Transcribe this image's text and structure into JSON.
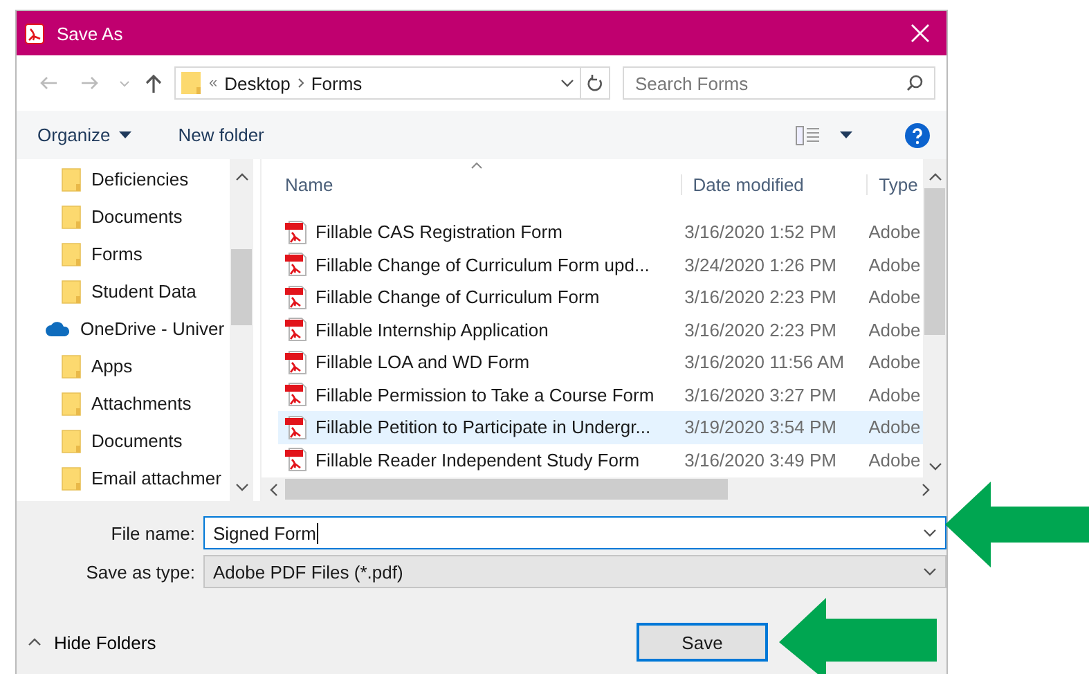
{
  "window": {
    "title": "Save As"
  },
  "address": {
    "overflow": "«",
    "crumbs": [
      "Desktop",
      "Forms"
    ]
  },
  "search": {
    "placeholder": "Search Forms"
  },
  "toolbar": {
    "buttons": [
      {
        "label": "Organize",
        "dropdown": true
      },
      {
        "label": "New folder",
        "dropdown": false
      }
    ]
  },
  "sidebar": {
    "items": [
      {
        "kind": "folder",
        "label": "Deficiencies"
      },
      {
        "kind": "folder",
        "label": "Documents"
      },
      {
        "kind": "folder",
        "label": "Forms"
      },
      {
        "kind": "folder",
        "label": "Student Data"
      },
      {
        "kind": "cloud",
        "label": "OneDrive - Univer",
        "children": [
          {
            "kind": "folder",
            "label": "Apps"
          },
          {
            "kind": "folder",
            "label": "Attachments"
          },
          {
            "kind": "folder",
            "label": "Documents"
          },
          {
            "kind": "folder",
            "label": "Email attachmer"
          }
        ]
      }
    ]
  },
  "file_list": {
    "columns": [
      "Name",
      "Date modified",
      "Type"
    ],
    "rows": [
      {
        "name": "Fillable CAS Registration Form",
        "date": "3/16/2020 1:52 PM",
        "type": "Adobe",
        "selected": false
      },
      {
        "name": "Fillable Change of Curriculum Form upd...",
        "date": "3/24/2020 1:26 PM",
        "type": "Adobe",
        "selected": false
      },
      {
        "name": "Fillable Change of Curriculum Form",
        "date": "3/16/2020 2:23 PM",
        "type": "Adobe",
        "selected": false
      },
      {
        "name": "Fillable Internship Application",
        "date": "3/16/2020 2:23 PM",
        "type": "Adobe",
        "selected": false
      },
      {
        "name": "Fillable LOA and WD Form",
        "date": "3/16/2020 11:56 AM",
        "type": "Adobe",
        "selected": false
      },
      {
        "name": "Fillable Permission to Take a Course Form",
        "date": "3/16/2020 3:27 PM",
        "type": "Adobe",
        "selected": false
      },
      {
        "name": "Fillable Petition to Participate in Undergr...",
        "date": "3/19/2020 3:54 PM",
        "type": "Adobe",
        "selected": true
      },
      {
        "name": "Fillable Reader Independent Study Form",
        "date": "3/16/2020 3:49 PM",
        "type": "Adobe",
        "selected": false
      }
    ]
  },
  "file_name": {
    "label": "File name:",
    "value": "Signed Form"
  },
  "save_as_type": {
    "label": "Save as type:",
    "value": "Adobe PDF Files (*.pdf)"
  },
  "hide_folders": {
    "label": "Hide Folders"
  },
  "save_button": {
    "label": "Save"
  }
}
